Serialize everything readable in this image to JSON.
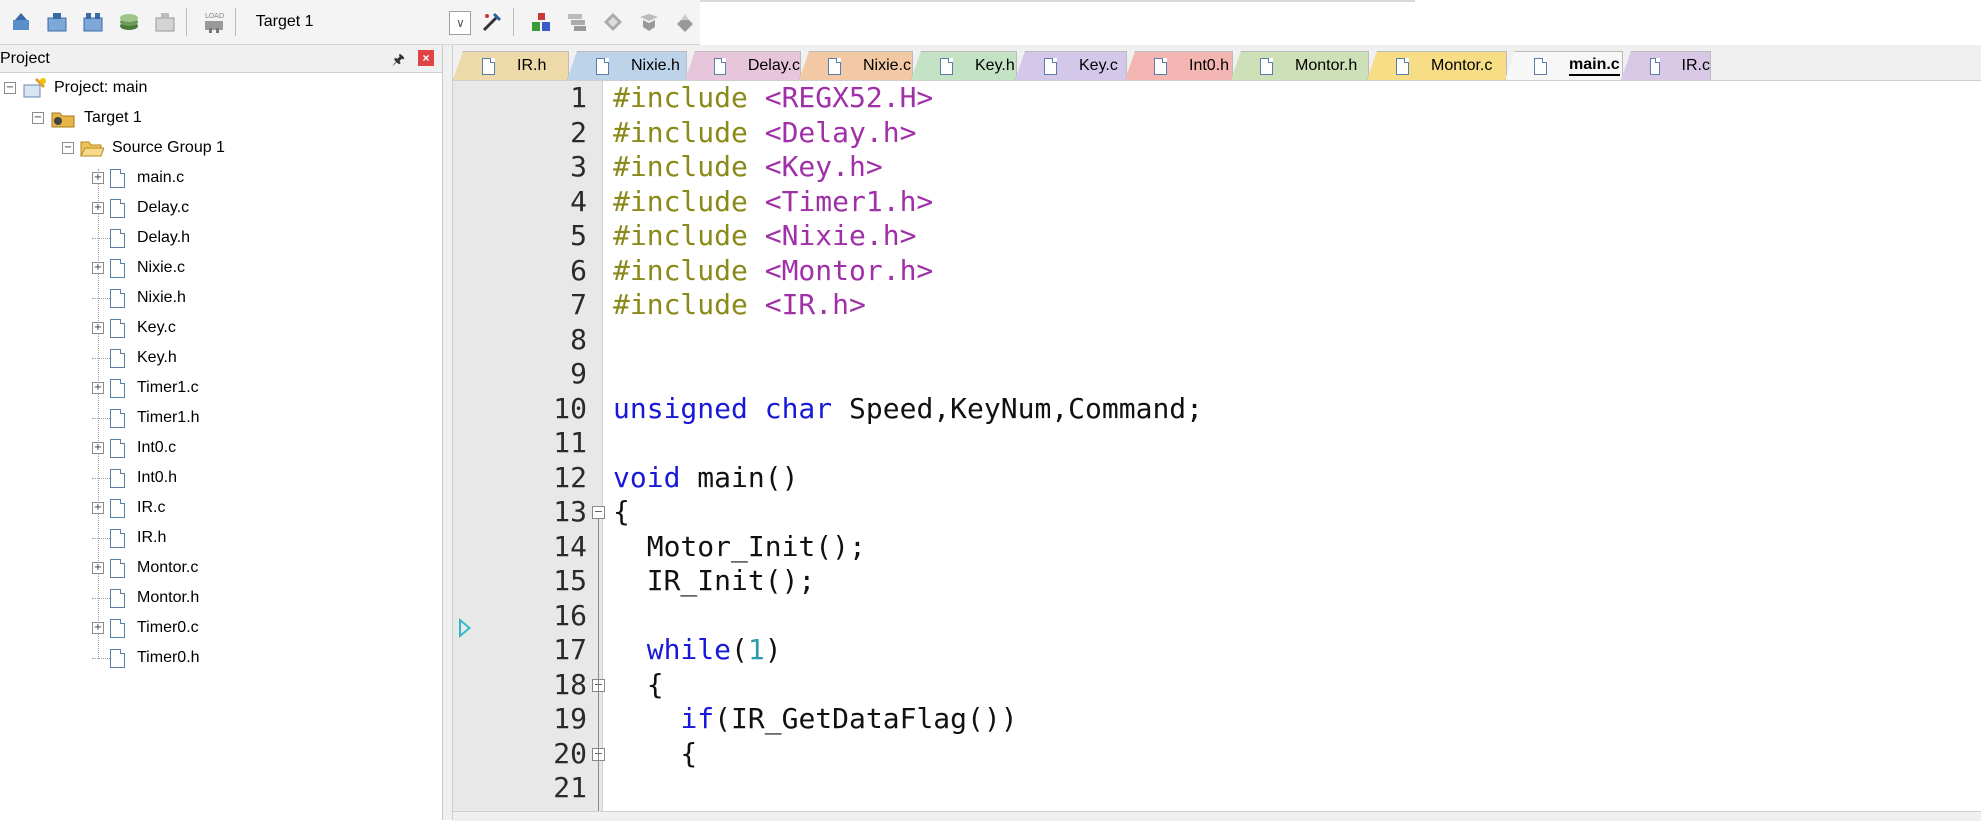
{
  "toolbar": {
    "target": "Target 1",
    "icons": [
      "translate-icon",
      "build-icon",
      "rebuild-icon",
      "batch-build-icon",
      "stop-build-icon",
      "download-icon",
      "target-options-icon",
      "manage-components-icon",
      "select-packs-icon",
      "pack-installer-icon",
      "book-icon",
      "manage-rte-icon"
    ],
    "load_label": "LOAD"
  },
  "project_panel": {
    "title": "Project",
    "root": "Project: main",
    "target": "Target 1",
    "group": "Source Group 1",
    "files": [
      {
        "name": "main.c",
        "expandable": true
      },
      {
        "name": "Delay.c",
        "expandable": true
      },
      {
        "name": "Delay.h",
        "expandable": false
      },
      {
        "name": "Nixie.c",
        "expandable": true
      },
      {
        "name": "Nixie.h",
        "expandable": false
      },
      {
        "name": "Key.c",
        "expandable": true
      },
      {
        "name": "Key.h",
        "expandable": false
      },
      {
        "name": "Timer1.c",
        "expandable": true
      },
      {
        "name": "Timer1.h",
        "expandable": false
      },
      {
        "name": "Int0.c",
        "expandable": true
      },
      {
        "name": "Int0.h",
        "expandable": false
      },
      {
        "name": "IR.c",
        "expandable": true
      },
      {
        "name": "IR.h",
        "expandable": false
      },
      {
        "name": "Montor.c",
        "expandable": true
      },
      {
        "name": "Montor.h",
        "expandable": false
      },
      {
        "name": "Timer0.c",
        "expandable": true
      },
      {
        "name": "Timer0.h",
        "expandable": false
      }
    ]
  },
  "tabs": [
    {
      "label": "IR.h",
      "color": "#eed9a8"
    },
    {
      "label": "Nixie.h",
      "color": "#bdd3ea"
    },
    {
      "label": "Delay.c",
      "color": "#e7c6dc"
    },
    {
      "label": "Nixie.c",
      "color": "#f2c9a4"
    },
    {
      "label": "Key.h",
      "color": "#c4e2c4"
    },
    {
      "label": "Key.c",
      "color": "#d4c8ea"
    },
    {
      "label": "Int0.h",
      "color": "#f4b6b2"
    },
    {
      "label": "Montor.h",
      "color": "#cde0b8"
    },
    {
      "label": "Montor.c",
      "color": "#f6dd86"
    },
    {
      "label": "main.c",
      "color": "#f7f7f7",
      "active": true
    },
    {
      "label": "IR.c",
      "color": "#d8c8e6"
    }
  ],
  "code_lines": [
    {
      "n": "1",
      "tokens": [
        [
          "pp",
          "#include "
        ],
        [
          "str",
          "<REGX52.H>"
        ]
      ]
    },
    {
      "n": "2",
      "tokens": [
        [
          "pp",
          "#include "
        ],
        [
          "str",
          "<Delay.h>"
        ]
      ]
    },
    {
      "n": "3",
      "tokens": [
        [
          "pp",
          "#include "
        ],
        [
          "str",
          "<Key.h>"
        ]
      ]
    },
    {
      "n": "4",
      "tokens": [
        [
          "pp",
          "#include "
        ],
        [
          "str",
          "<Timer1.h>"
        ]
      ]
    },
    {
      "n": "5",
      "tokens": [
        [
          "pp",
          "#include "
        ],
        [
          "str",
          "<Nixie.h>"
        ]
      ]
    },
    {
      "n": "6",
      "tokens": [
        [
          "pp",
          "#include "
        ],
        [
          "str",
          "<Montor.h>"
        ]
      ]
    },
    {
      "n": "7",
      "tokens": [
        [
          "pp",
          "#include "
        ],
        [
          "str",
          "<IR.h>"
        ]
      ]
    },
    {
      "n": "8",
      "tokens": []
    },
    {
      "n": "9",
      "tokens": []
    },
    {
      "n": "10",
      "tokens": [
        [
          "kw",
          "unsigned char"
        ],
        [
          "plain",
          " Speed,KeyNum,Command;"
        ]
      ]
    },
    {
      "n": "11",
      "tokens": []
    },
    {
      "n": "12",
      "tokens": [
        [
          "kw",
          "void"
        ],
        [
          "plain",
          " main()"
        ]
      ]
    },
    {
      "n": "13",
      "tokens": [
        [
          "plain",
          "{"
        ]
      ]
    },
    {
      "n": "14",
      "tokens": [
        [
          "plain",
          "  Motor_Init();"
        ]
      ]
    },
    {
      "n": "15",
      "tokens": [
        [
          "plain",
          "  IR_Init();"
        ]
      ]
    },
    {
      "n": "16",
      "tokens": []
    },
    {
      "n": "17",
      "tokens": [
        [
          "plain",
          "  "
        ],
        [
          "kw",
          "while"
        ],
        [
          "plain",
          "("
        ],
        [
          "num",
          "1"
        ],
        [
          "plain",
          ")"
        ]
      ]
    },
    {
      "n": "18",
      "tokens": [
        [
          "plain",
          "  {"
        ]
      ]
    },
    {
      "n": "19",
      "tokens": [
        [
          "plain",
          "    "
        ],
        [
          "kw",
          "if"
        ],
        [
          "plain",
          "(IR_GetDataFlag())"
        ]
      ]
    },
    {
      "n": "20",
      "tokens": [
        [
          "plain",
          "    {"
        ]
      ]
    },
    {
      "n": "21",
      "tokens": []
    }
  ]
}
